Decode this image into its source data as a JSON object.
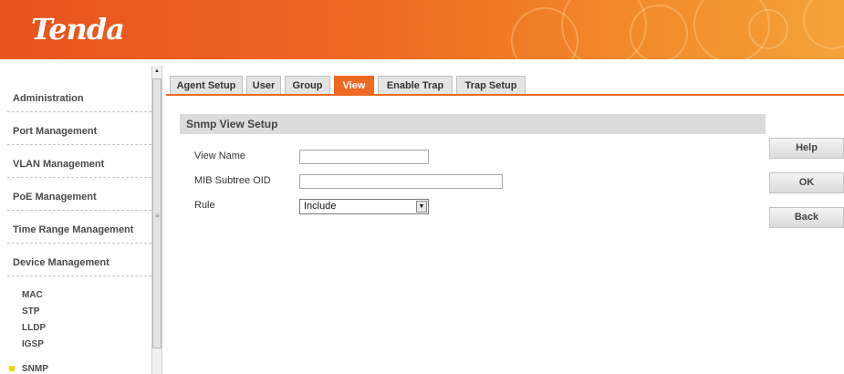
{
  "header": {
    "logo": "Tenda"
  },
  "sidebar": {
    "items": [
      {
        "label": "Administration"
      },
      {
        "label": "Port Management"
      },
      {
        "label": "VLAN Management"
      },
      {
        "label": "PoE Management"
      },
      {
        "label": "Time Range Management"
      },
      {
        "label": "Device Management"
      }
    ],
    "sub_items": [
      {
        "label": "MAC"
      },
      {
        "label": "STP"
      },
      {
        "label": "LLDP"
      },
      {
        "label": "IGSP"
      },
      {
        "label": "SNMP"
      }
    ]
  },
  "tabs": [
    {
      "label": "Agent Setup"
    },
    {
      "label": "User"
    },
    {
      "label": "Group"
    },
    {
      "label": "View",
      "active": true
    },
    {
      "label": "Enable Trap"
    },
    {
      "label": "Trap Setup"
    }
  ],
  "section": {
    "title": "Snmp View Setup"
  },
  "form": {
    "view_name": {
      "label": "View Name",
      "value": ""
    },
    "mib_oid": {
      "label": "MIB Subtree OID",
      "value": ""
    },
    "rule": {
      "label": "Rule",
      "value": "Include"
    }
  },
  "buttons": {
    "help": "Help",
    "ok": "OK",
    "back": "Back"
  },
  "colors": {
    "accent": "#ee6a22",
    "header": "#e8531e",
    "selected_marker": "#ffd200"
  }
}
